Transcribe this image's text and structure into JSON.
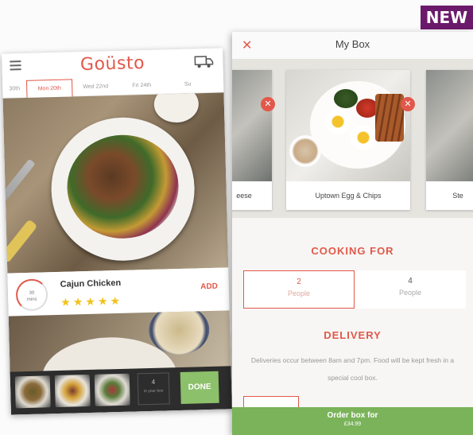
{
  "badge": "NEW",
  "left_app": {
    "logo": "Goüsto",
    "days": [
      "30th",
      "Mon 20th",
      "Wed 22nd",
      "Fri 24th",
      "Su"
    ],
    "recipe": {
      "time_value": "30",
      "time_unit": "mins",
      "name": "Cajun Chicken",
      "stars": "★★★★★",
      "add_label": "ADD"
    },
    "box_bar": {
      "count": "4",
      "count_sub": "in your box",
      "done_label": "DONE"
    }
  },
  "right_app": {
    "title": "My Box",
    "close_glyph": "✕",
    "carousel": [
      "eese",
      "Uptown Egg & Chips",
      "Ste"
    ],
    "cooking_for": {
      "title": "COOKING FOR",
      "options": [
        {
          "value": "2",
          "label": "People"
        },
        {
          "value": "4",
          "label": "People"
        }
      ]
    },
    "delivery": {
      "title": "DELIVERY",
      "text": "Deliveries occur between 8am and 7pm. Food will be kept fresh in a special cool box."
    },
    "order": {
      "label": "Order box for",
      "price": "£34.99"
    }
  },
  "colors": {
    "accent": "#e2584a",
    "done_green": "#8cc06a",
    "order_green": "#7ab35a",
    "badge_purple": "#6b1a6b"
  }
}
